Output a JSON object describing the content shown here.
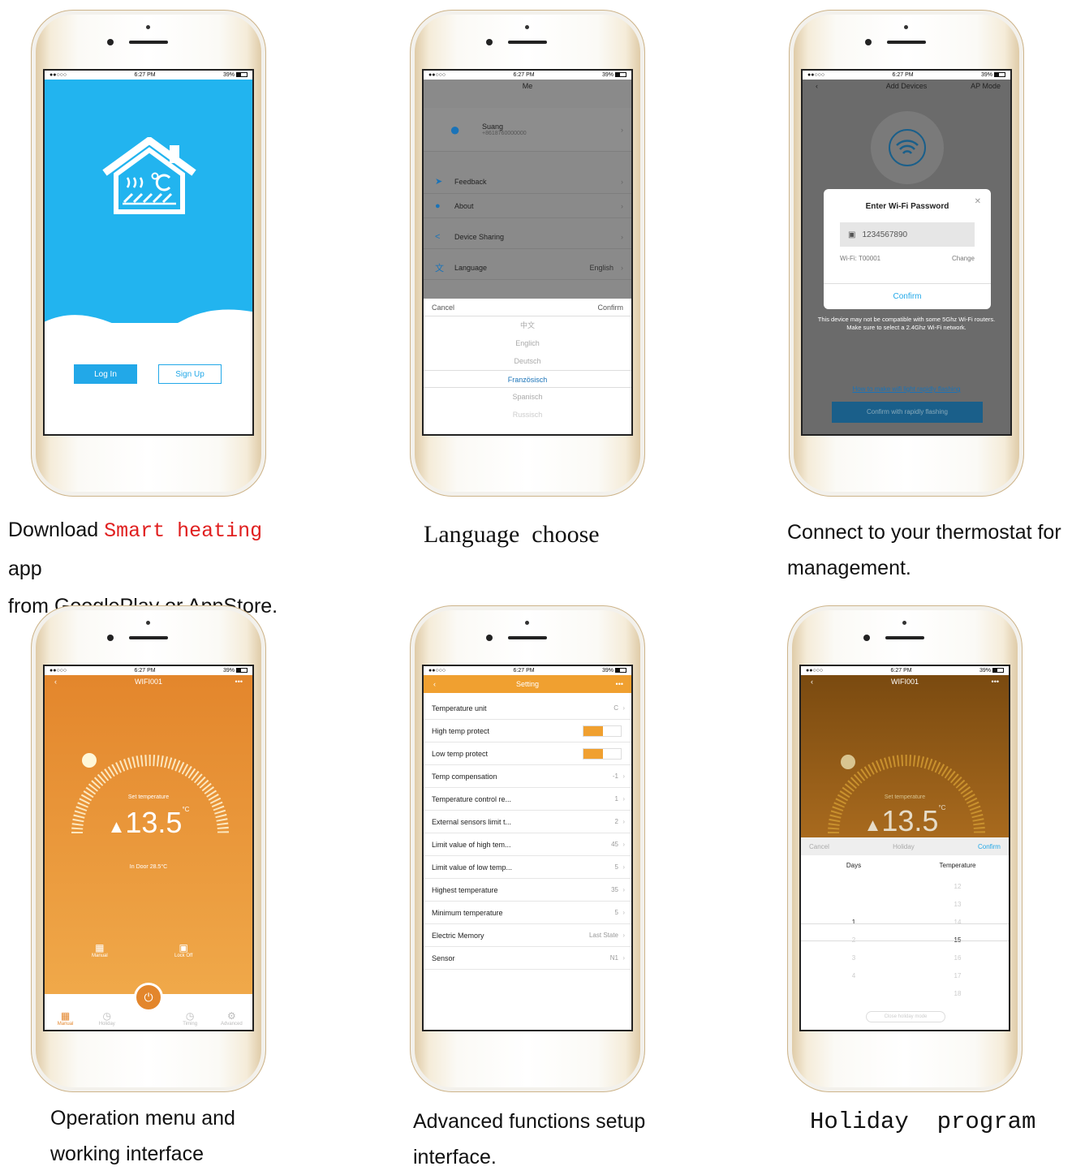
{
  "status": {
    "carrier": "●●○○○",
    "time": "6:27 PM",
    "battery": "39%"
  },
  "panel1": {
    "login_label": "Log In",
    "signup_label": "Sign Up",
    "caption_line1_pre": "Download",
    "caption_brand": "Smart heating",
    "caption_line1_post": "app",
    "caption_line2": "from GooglePlay or AppStore."
  },
  "panel2": {
    "title": "Me",
    "profile_name": "Suang",
    "profile_sub": "+8618760000000",
    "menu": [
      {
        "label": "Feedback",
        "value": ""
      },
      {
        "label": "About",
        "value": ""
      },
      {
        "label": "Device Sharing",
        "value": ""
      },
      {
        "label": "Language",
        "value": "English"
      }
    ],
    "cancel_label": "Cancel",
    "confirm_label": "Confirm",
    "languages": [
      "中文",
      "Englich",
      "Deutsch",
      "Französisch",
      "Spanisch",
      "Russisch"
    ],
    "caption": "Language  choose"
  },
  "panel3": {
    "title": "Add Devices",
    "mode": "AP Mode",
    "dialog_title": "Enter Wi-Fi Password",
    "password": "1234567890",
    "network": "Wi-Fi: T00001",
    "change_label": "Change",
    "confirm_label": "Confirm",
    "warning": "This device may not be compatible with some 5Ghz Wi-Fi routers. Make sure to select a 2.4Ghz Wi-Fi network.",
    "help_link": "How to make wifi light rapidly flashing",
    "rapid_button": "Confirm with rapidly flashing",
    "caption_line1": "Connect to your thermostat for",
    "caption_line2": "management."
  },
  "panel4": {
    "title": "WIFI001",
    "set_label": "Set temperature",
    "temperature": "13.5",
    "unit": "°C",
    "indoor": "In Door 28.5°C",
    "manual_label": "Manual",
    "lock_label": "Lock Off",
    "tabs": [
      "Manual",
      "Holiday",
      "",
      "Timing",
      "Advanced"
    ],
    "caption_line1": "Operation menu and",
    "caption_line2": "working interface"
  },
  "panel5": {
    "title": "Setting",
    "rows": [
      {
        "label": "Temperature unit",
        "value": "C"
      },
      {
        "label": "High temp protect",
        "value": ""
      },
      {
        "label": "Low temp protect",
        "value": ""
      },
      {
        "label": "Temp compensation",
        "value": "-1"
      },
      {
        "label": "Temperature control re...",
        "value": "1"
      },
      {
        "label": "External sensors limit t...",
        "value": "2"
      },
      {
        "label": "Limit value of high tem...",
        "value": "45"
      },
      {
        "label": "Limit value of low temp...",
        "value": "5"
      },
      {
        "label": "Highest temperature",
        "value": "35"
      },
      {
        "label": "Minimum temperature",
        "value": "5"
      },
      {
        "label": "Electric Memory",
        "value": "Last State"
      },
      {
        "label": "Sensor",
        "value": "N1"
      }
    ],
    "caption_line1": "Advanced functions setup",
    "caption_line2": "interface."
  },
  "panel6": {
    "title": "WIFI001",
    "set_label": "Set temperature",
    "temperature": "13.5",
    "unit": "°C",
    "cancel_label": "Cancel",
    "sheet_title": "Holiday",
    "confirm_label": "Confirm",
    "days_header": "Days",
    "temp_header": "Temperature",
    "days": [
      "",
      "",
      "",
      "1",
      "2",
      "3",
      "4"
    ],
    "temps": [
      "12",
      "13",
      "14",
      "15",
      "16",
      "17",
      "18"
    ],
    "close_label": "Close holiday mode",
    "caption": "Holiday  program"
  },
  "colors": {
    "blue": "#22b4ef",
    "orange": "#e3862c",
    "red": "#e02020"
  }
}
